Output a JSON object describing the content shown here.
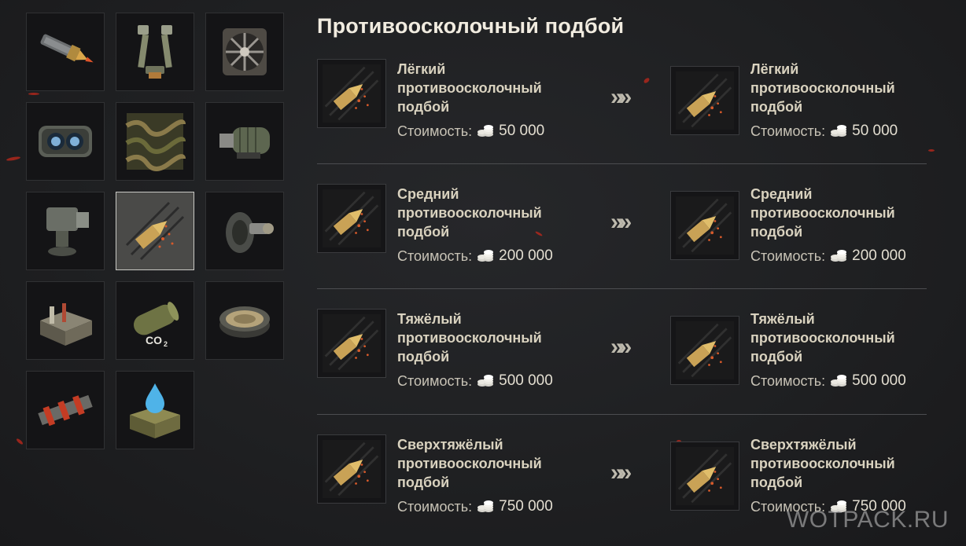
{
  "title": "Противоосколочный подбой",
  "rows": [
    {
      "left": {
        "name": [
          "Лёгкий",
          "противоосколочный",
          "подбой"
        ],
        "cost_label": "Стоимость:",
        "cost_value": "50 000"
      },
      "right": {
        "name": [
          "Лёгкий",
          "противоосколочный",
          "подбой"
        ],
        "cost_label": "Стоимость:",
        "cost_value": "50 000"
      }
    },
    {
      "left": {
        "name": [
          "Средний",
          "противоосколочный",
          "подбой"
        ],
        "cost_label": "Стоимость:",
        "cost_value": "200 000"
      },
      "right": {
        "name": [
          "Средний",
          "противоосколочный",
          "подбой"
        ],
        "cost_label": "Стоимость:",
        "cost_value": "200 000"
      }
    },
    {
      "left": {
        "name": [
          "Тяжёлый",
          "противоосколочный",
          "подбой"
        ],
        "cost_label": "Стоимость:",
        "cost_value": "500 000"
      },
      "right": {
        "name": [
          "Тяжёлый",
          "противоосколочный",
          "подбой"
        ],
        "cost_label": "Стоимость:",
        "cost_value": "500 000"
      }
    },
    {
      "left": {
        "name": [
          "Сверхтяжёлый",
          "противоосколочный",
          "подбой"
        ],
        "cost_label": "Стоимость:",
        "cost_value": "750 000"
      },
      "right": {
        "name": [
          "Сверхтяжёлый",
          "противоосколочный",
          "подбой"
        ],
        "cost_label": "Стоимость:",
        "cost_value": "750 000"
      }
    }
  ],
  "arrow": "»",
  "watermark": "WOTPACK.RU",
  "equipment_icons": [
    "rammer-icon",
    "stereo-periscope-icon",
    "ventilation-icon",
    "optics-icon",
    "camouflage-net-icon",
    "turbocharger-icon",
    "gun-laying-drive-icon",
    "spall-liner-icon",
    "suspension-icon",
    "toolbox-icon",
    "fire-extinguisher-icon",
    "wet-ammo-rack-icon",
    "track-grousers-icon",
    "water-tank-icon"
  ],
  "selected_icon": "spall-liner-icon",
  "colors": {
    "background": "#1f2022",
    "title": "#f1ece0",
    "name": "#d9d2bf",
    "selected_cell": "#4a4a48",
    "ember": "#b8281c"
  }
}
